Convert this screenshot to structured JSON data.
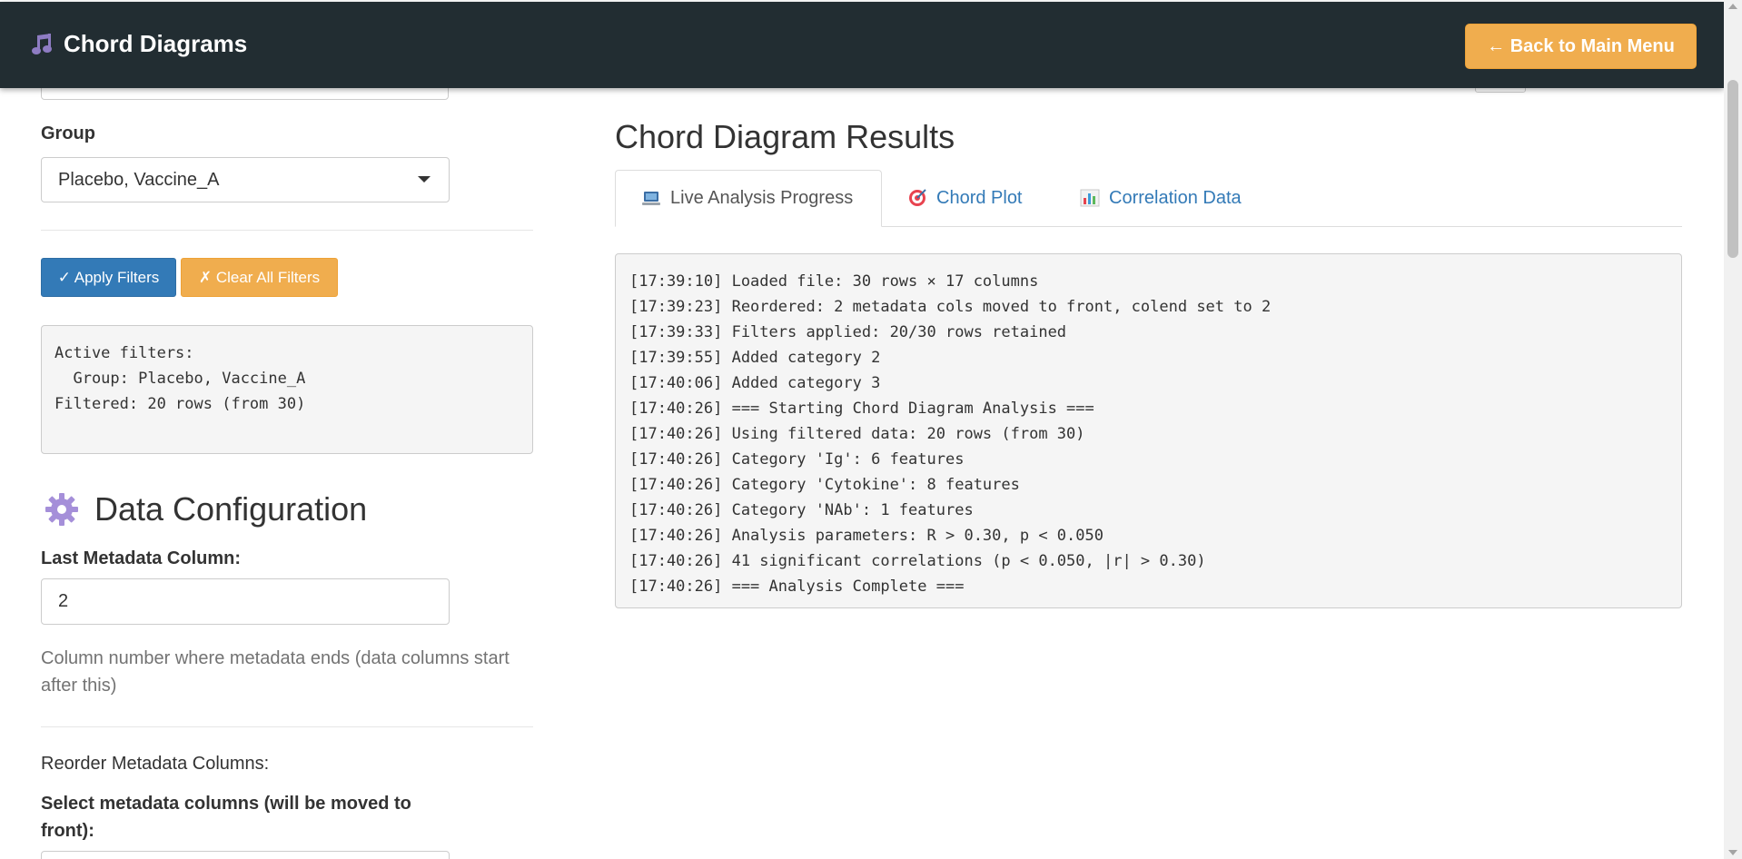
{
  "header": {
    "title": "Chord Diagrams",
    "back_button_label": "← Back to Main Menu",
    "brand_icon": "music-note-icon"
  },
  "sidebar": {
    "group_label": "Group",
    "group_selected": "Placebo, Vaccine_A",
    "apply_label": "✓ Apply Filters",
    "clear_label": "✗ Clear All Filters",
    "filter_summary": [
      "Active filters:",
      "  Group: Placebo, Vaccine_A",
      "",
      "Filtered: 20 rows (from 30)"
    ],
    "data_config": {
      "heading": "Data Configuration",
      "heading_icon": "gear-icon",
      "last_meta_label": "Last Metadata Column:",
      "last_meta_value": "2",
      "help_text": "Column number where metadata ends (data columns start after this)",
      "reorder_label": "Reorder Metadata Columns:",
      "select_meta_label": "Select metadata columns (will be moved to front):"
    }
  },
  "main": {
    "title": "Chord Diagram Results",
    "tabs": [
      {
        "label": "Live Analysis Progress",
        "icon": "laptop-icon",
        "active": true
      },
      {
        "label": "Chord Plot",
        "icon": "target-icon",
        "active": false
      },
      {
        "label": "Correlation Data",
        "icon": "bar-chart-icon",
        "active": false
      }
    ],
    "log_lines": [
      "[17:39:10] Loaded file: 30 rows × 17 columns",
      "[17:39:23] Reordered: 2 metadata cols moved to front, colend set to 2",
      "[17:39:33] Filters applied: 20/30 rows retained",
      "[17:39:55] Added category 2",
      "[17:40:06] Added category 3",
      "[17:40:26] === Starting Chord Diagram Analysis ===",
      "[17:40:26] Using filtered data: 20 rows (from 30)",
      "[17:40:26] Category 'Ig': 6 features",
      "[17:40:26] Category 'Cytokine': 8 features",
      "[17:40:26] Category 'NAb': 1 features",
      "[17:40:26] Analysis parameters: R > 0.30, p < 0.050",
      "[17:40:26] 41 significant correlations (p < 0.050, |r| > 0.30)",
      "[17:40:26] === Analysis Complete ==="
    ]
  },
  "colors": {
    "header_bg": "#222d32",
    "primary": "#337ab7",
    "warning": "#f0ad4e"
  }
}
